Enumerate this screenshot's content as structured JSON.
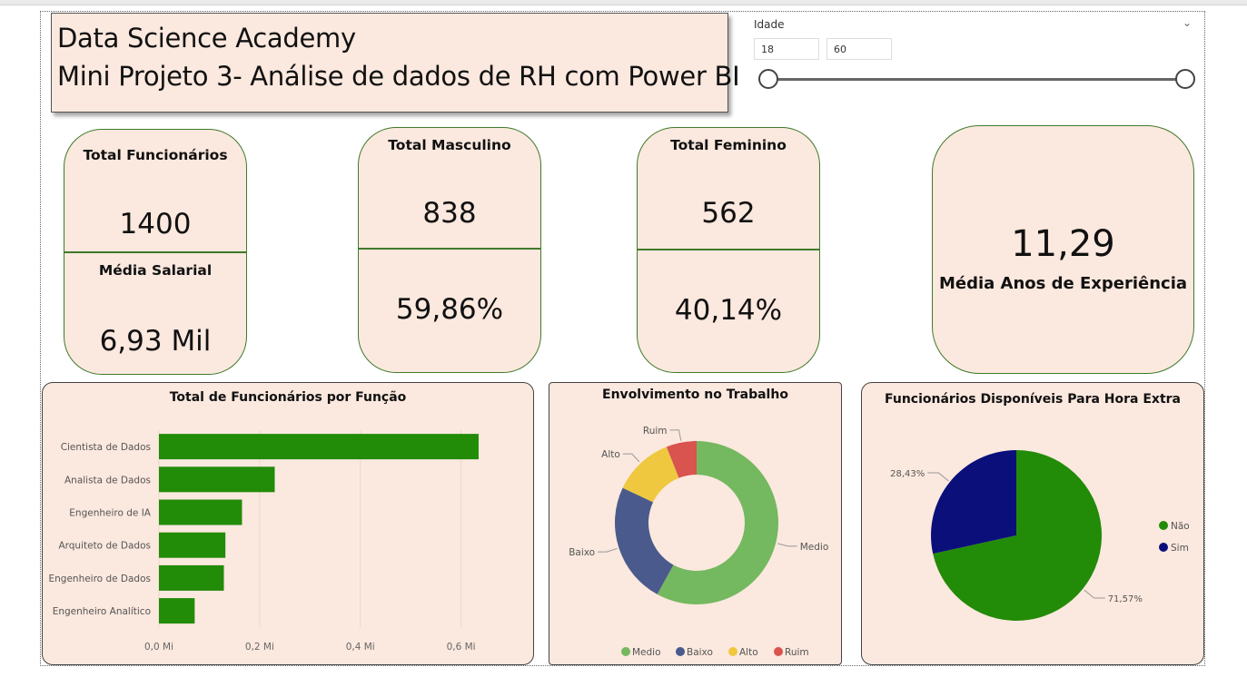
{
  "header": {
    "line1": "Data Science Academy",
    "line2": "Mini Projeto 3- Análise de dados de RH com Power BI"
  },
  "slicer": {
    "label": "Idade",
    "min_value": "18",
    "max_value": "60",
    "range_min_fraction": 0,
    "range_max_fraction": 1
  },
  "cards": {
    "total_funcionarios": {
      "label": "Total Funcionários",
      "value": "1400"
    },
    "media_salarial": {
      "label": "Média Salarial",
      "value": "6,93 Mil"
    },
    "total_masculino": {
      "label": "Total Masculino",
      "value": "838",
      "pct": "59,86%"
    },
    "total_feminino": {
      "label": "Total Feminino",
      "value": "562",
      "pct": "40,14%"
    },
    "media_anos": {
      "label": "Média Anos de Experiência",
      "value": "11,29"
    }
  },
  "colors": {
    "card_bg": "#fbe8de",
    "card_border": "#3f7a2a",
    "bar_green": "#228b08",
    "medio": "#74b85f",
    "baixo": "#4a5a8c",
    "alto": "#efc840",
    "ruim": "#d9534f",
    "nao": "#228b08",
    "sim": "#0b0f7a"
  },
  "chart_data": [
    {
      "type": "bar",
      "orientation": "horizontal",
      "title": "Total de Funcionários por Função",
      "categories": [
        "Cientista de Dados",
        "Analista de Dados",
        "Engenheiro de IA",
        "Arquiteto de Dados",
        "Engenheiro de Dados",
        "Engenheiro Analítico"
      ],
      "values": [
        0.635,
        0.23,
        0.165,
        0.132,
        0.129,
        0.071
      ],
      "xlim": [
        0,
        0.7
      ],
      "xticks": [
        0,
        0.2,
        0.4,
        0.6
      ],
      "xtick_labels": [
        "0,0 Mi",
        "0,2 Mi",
        "0,4 Mi",
        "0,6 Mi"
      ],
      "grid": true
    },
    {
      "type": "pie",
      "variant": "donut",
      "title": "Envolvimento no Trabalho",
      "labels": [
        "Medio",
        "Baixo",
        "Alto",
        "Ruim"
      ],
      "values": [
        58,
        24,
        12,
        6
      ],
      "legend": "bottom"
    },
    {
      "type": "pie",
      "title": "Funcionários Disponíveis Para Hora Extra",
      "labels": [
        "Não",
        "Sim"
      ],
      "values": [
        71.57,
        28.43
      ],
      "data_labels": [
        "71,57%",
        "28,43%"
      ],
      "legend": "right"
    }
  ]
}
